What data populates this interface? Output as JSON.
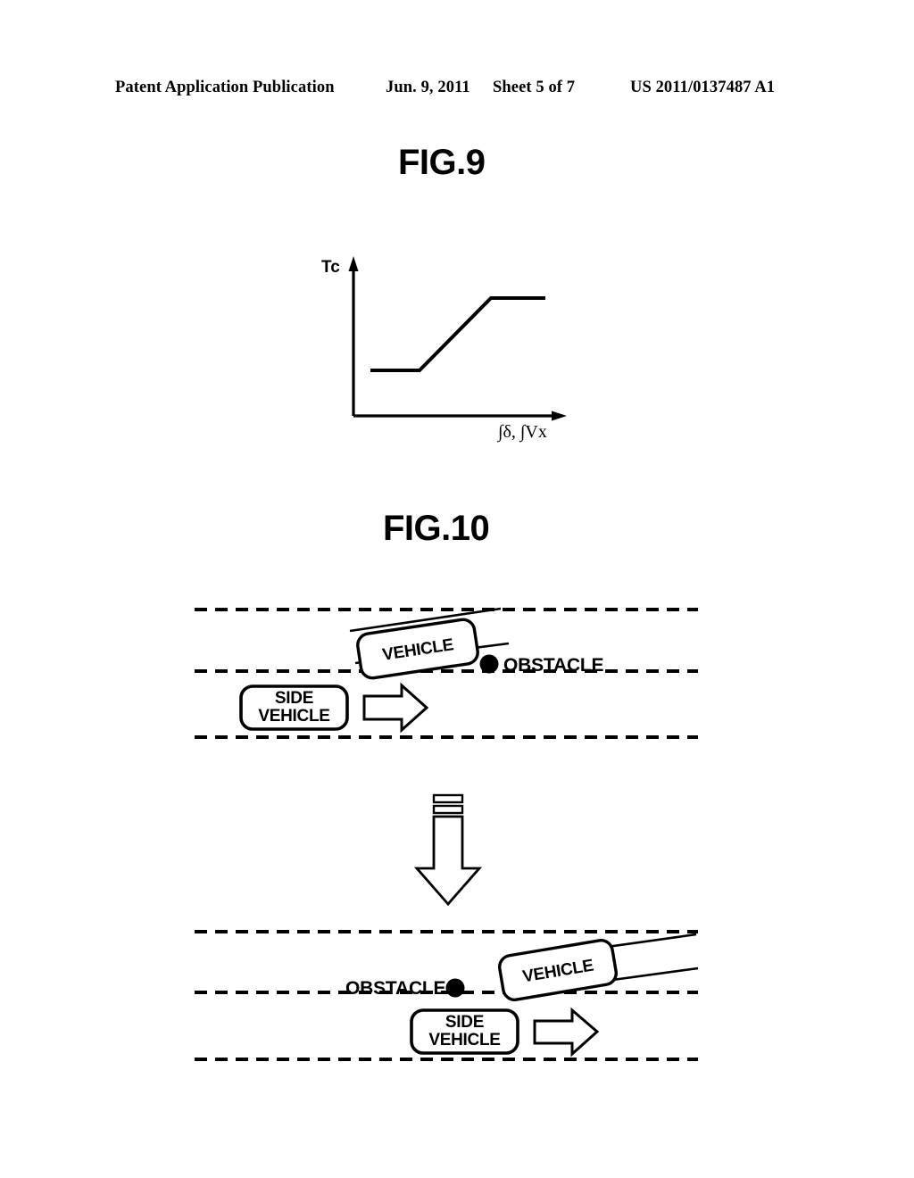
{
  "header": {
    "publication": "Patent Application Publication",
    "date": "Jun. 9, 2011",
    "sheet": "Sheet 5 of 7",
    "document_number": "US 2011/0137487 A1"
  },
  "figures": [
    {
      "id": "fig9",
      "title": "FIG.9",
      "y_axis_label": "Tc",
      "x_axis_label": "∫δ, ∫Vx"
    },
    {
      "id": "fig10",
      "title": "FIG.10",
      "top_scene": {
        "vehicle_label": "VEHICLE",
        "obstacle_label": "OBSTACLE",
        "side_vehicle_label_line1": "SIDE",
        "side_vehicle_label_line2": "VEHICLE"
      },
      "transition_arrow": "down-arrow",
      "bottom_scene": {
        "vehicle_label": "VEHICLE",
        "obstacle_label": "OBSTACLE",
        "side_vehicle_label_line1": "SIDE",
        "side_vehicle_label_line2": "VEHICLE"
      }
    }
  ],
  "chart_data": {
    "type": "line",
    "title": "FIG.9",
    "xlabel": "∫δ, ∫Vx",
    "ylabel": "Tc",
    "description": "Piecewise-linear saturating characteristic: constant low value, linear ramp up, then constant high value (clipped).",
    "x": [
      0.12,
      0.34,
      0.62,
      0.86
    ],
    "y": [
      0.28,
      0.28,
      0.72,
      0.72
    ],
    "xlim": [
      0,
      1
    ],
    "ylim": [
      0,
      1
    ],
    "grid": false,
    "legend": false,
    "axis_arrows": true,
    "tick_labels": []
  },
  "colors": {
    "ink": "#000000",
    "paper": "#ffffff"
  }
}
